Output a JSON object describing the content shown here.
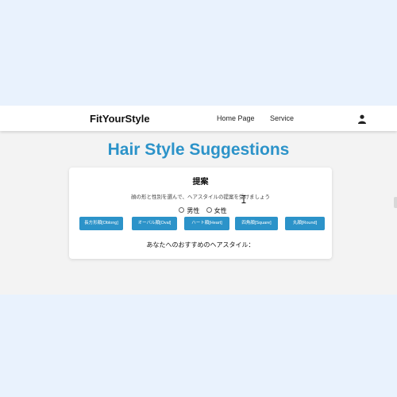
{
  "navbar": {
    "brand": "FitYourStyle",
    "links": [
      "Home Page",
      "Service"
    ],
    "user_icon": "user-icon"
  },
  "page": {
    "title": "Hair Style Suggestions"
  },
  "card": {
    "title": "提案",
    "description": "顔の形と性別を選んで、ヘアスタイルの提案を受けましょう",
    "gender_options": [
      "男性",
      "女性"
    ],
    "face_shapes": [
      "長方形顔[Oblong]",
      "オーバル顔[Oval]",
      "ハート顔[Heart]",
      "四角顔[Square]",
      "丸顔[Round]"
    ],
    "result_label": "あなたへのおすすめのヘアスタイル："
  },
  "colors": {
    "accent": "#2c93c9",
    "page_background": "#e9f2fd",
    "band_background": "#f3f3f3",
    "card_background": "#ffffff"
  }
}
